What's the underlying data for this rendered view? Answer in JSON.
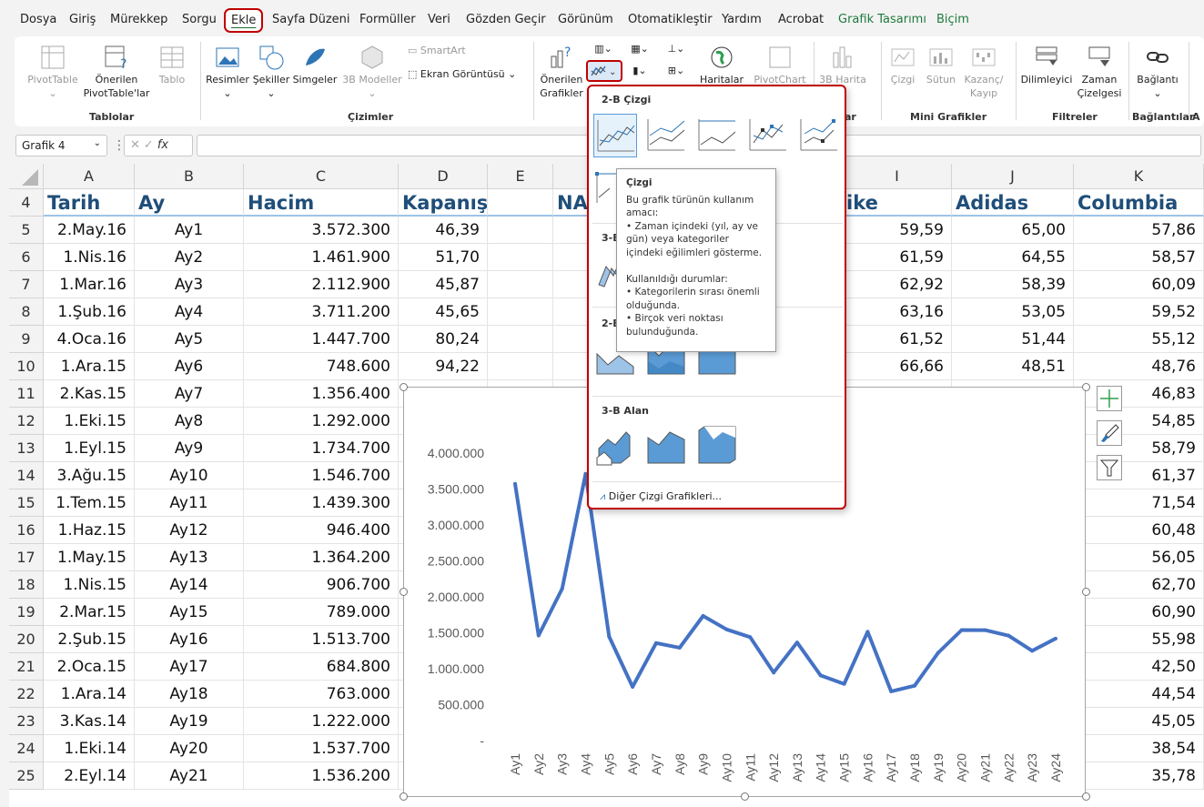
{
  "menu": {
    "tabs": [
      "Dosya",
      "Giriş",
      "Mürekkep",
      "Sorgu",
      "Ekle",
      "Sayfa Düzeni",
      "Formüller",
      "Veri",
      "Gözden Geçir",
      "Görünüm",
      "Otomatikleştir",
      "Yardım",
      "Acrobat",
      "Grafik Tasarımı",
      "Biçim"
    ],
    "active": "Ekle"
  },
  "ribbon": {
    "pivot_table": "PivotTable",
    "recommended_pivot_1": "Önerilen",
    "recommended_pivot_2": "PivotTable'lar",
    "table": "Tablo",
    "group_tables": "Tablolar",
    "pictures": "Resimler",
    "shapes": "Şekiller",
    "icons": "Simgeler",
    "models_3d": "3B Modeller",
    "smartart": "SmartArt",
    "screenshot": "Ekran Görüntüsü",
    "group_illustrations": "Çizimler",
    "recommended_charts_1": "Önerilen",
    "recommended_charts_2": "Grafikler",
    "maps": "Haritalar",
    "pivotchart": "PivotChart",
    "map_3d": "3B Harita",
    "group_charts_tail": "ar",
    "spark_line": "Çizgi",
    "spark_column": "Sütun",
    "spark_winloss_1": "Kazanç/",
    "spark_winloss_2": "Kayıp",
    "group_sparklines": "Mini Grafikler",
    "slicer": "Dilimleyici",
    "timeline_1": "Zaman",
    "timeline_2": "Çizelgesi",
    "group_filters": "Filtreler",
    "link": "Bağlantı",
    "group_links": "Bağlantılar",
    "group_tail": "A"
  },
  "formula_bar": {
    "name_box": "Grafik 4",
    "fx": "fx",
    "formula": ""
  },
  "columns": [
    "A",
    "B",
    "C",
    "D",
    "E",
    "",
    "",
    "",
    "",
    "I",
    "J",
    "K"
  ],
  "headers": {
    "row": "4",
    "tarih": "Tarih",
    "ay": "Ay",
    "hacim": "Hacim",
    "kapanis": "Kapanış",
    "na": "NA",
    "nike": "ike",
    "adidas": "Adidas",
    "columbia": "Columbia"
  },
  "rows": [
    {
      "n": "5",
      "tarih": "2.May.16",
      "ay": "Ay1",
      "hacim": "3.572.300",
      "kapanis": "46,39",
      "nike": "59,59",
      "adidas": "65,00",
      "columbia": "57,86"
    },
    {
      "n": "6",
      "tarih": "1.Nis.16",
      "ay": "Ay2",
      "hacim": "1.461.900",
      "kapanis": "51,70",
      "nike": "61,59",
      "adidas": "64,55",
      "columbia": "58,57"
    },
    {
      "n": "7",
      "tarih": "1.Mar.16",
      "ay": "Ay3",
      "hacim": "2.112.900",
      "kapanis": "45,87",
      "nike": "62,92",
      "adidas": "58,39",
      "columbia": "60,09"
    },
    {
      "n": "8",
      "tarih": "1.Şub.16",
      "ay": "Ay4",
      "hacim": "3.711.200",
      "kapanis": "45,65",
      "nike": "63,16",
      "adidas": "53,05",
      "columbia": "59,52"
    },
    {
      "n": "9",
      "tarih": "4.Oca.16",
      "ay": "Ay5",
      "hacim": "1.447.700",
      "kapanis": "80,24",
      "nike": "61,52",
      "adidas": "51,44",
      "columbia": "55,12"
    },
    {
      "n": "10",
      "tarih": "1.Ara.15",
      "ay": "Ay6",
      "hacim": "748.600",
      "kapanis": "94,22",
      "nike": "66,66",
      "adidas": "48,51",
      "columbia": "48,76"
    },
    {
      "n": "11",
      "tarih": "2.Kas.15",
      "ay": "Ay7",
      "hacim": "1.356.400",
      "kapanis": "",
      "nike": "",
      "adidas": "",
      "columbia": "46,83"
    },
    {
      "n": "12",
      "tarih": "1.Eki.15",
      "ay": "Ay8",
      "hacim": "1.292.000",
      "kapanis": "",
      "nike": "",
      "adidas": "",
      "columbia": "54,85"
    },
    {
      "n": "13",
      "tarih": "1.Eyl.15",
      "ay": "Ay9",
      "hacim": "1.734.700",
      "kapanis": "",
      "nike": "",
      "adidas": "",
      "columbia": "58,79"
    },
    {
      "n": "14",
      "tarih": "3.Ağu.15",
      "ay": "Ay10",
      "hacim": "1.546.700",
      "kapanis": "",
      "nike": "",
      "adidas": "",
      "columbia": "61,37"
    },
    {
      "n": "15",
      "tarih": "1.Tem.15",
      "ay": "Ay11",
      "hacim": "1.439.300",
      "kapanis": "",
      "nike": "",
      "adidas": "",
      "columbia": "71,54"
    },
    {
      "n": "16",
      "tarih": "1.Haz.15",
      "ay": "Ay12",
      "hacim": "946.400",
      "kapanis": "",
      "nike": "",
      "adidas": "",
      "columbia": "60,48"
    },
    {
      "n": "17",
      "tarih": "1.May.15",
      "ay": "Ay13",
      "hacim": "1.364.200",
      "kapanis": "",
      "nike": "",
      "adidas": "",
      "columbia": "56,05"
    },
    {
      "n": "18",
      "tarih": "1.Nis.15",
      "ay": "Ay14",
      "hacim": "906.700",
      "kapanis": "",
      "nike": "",
      "adidas": "",
      "columbia": "62,70"
    },
    {
      "n": "19",
      "tarih": "2.Mar.15",
      "ay": "Ay15",
      "hacim": "789.000",
      "kapanis": "",
      "nike": "",
      "adidas": "",
      "columbia": "60,90"
    },
    {
      "n": "20",
      "tarih": "2.Şub.15",
      "ay": "Ay16",
      "hacim": "1.513.700",
      "kapanis": "",
      "nike": "",
      "adidas": "",
      "columbia": "55,98"
    },
    {
      "n": "21",
      "tarih": "2.Oca.15",
      "ay": "Ay17",
      "hacim": "684.800",
      "kapanis": "",
      "nike": "",
      "adidas": "",
      "columbia": "42,50"
    },
    {
      "n": "22",
      "tarih": "1.Ara.14",
      "ay": "Ay18",
      "hacim": "763.000",
      "kapanis": "",
      "nike": "",
      "adidas": "",
      "columbia": "44,54"
    },
    {
      "n": "23",
      "tarih": "3.Kas.14",
      "ay": "Ay19",
      "hacim": "1.222.000",
      "kapanis": "",
      "nike": "",
      "adidas": "",
      "columbia": "45,05"
    },
    {
      "n": "24",
      "tarih": "1.Eki.14",
      "ay": "Ay20",
      "hacim": "1.537.700",
      "kapanis": "",
      "nike": "",
      "adidas": "",
      "columbia": "38,54"
    },
    {
      "n": "25",
      "tarih": "2.Eyl.14",
      "ay": "Ay21",
      "hacim": "1.536.200",
      "kapanis": "",
      "nike": "",
      "adidas": "",
      "columbia": "35,78"
    }
  ],
  "chart_data": {
    "type": "line",
    "categories": [
      "Ay1",
      "Ay2",
      "Ay3",
      "Ay4",
      "Ay5",
      "Ay6",
      "Ay7",
      "Ay8",
      "Ay9",
      "Ay10",
      "Ay11",
      "Ay12",
      "Ay13",
      "Ay14",
      "Ay15",
      "Ay16",
      "Ay17",
      "Ay18",
      "Ay19",
      "Ay20",
      "Ay21",
      "Ay22",
      "Ay23",
      "Ay24"
    ],
    "series": [
      {
        "values": [
          3572300,
          1461900,
          2112900,
          3711200,
          1447700,
          748600,
          1356400,
          1292000,
          1734700,
          1546700,
          1439300,
          946400,
          1364200,
          906700,
          789000,
          1513700,
          684800,
          763000,
          1222000,
          1537700,
          1536200,
          1460000,
          1250000,
          1420000
        ]
      }
    ],
    "yticks": [
      "4.000.000",
      "3.500.000",
      "3.000.000",
      "2.500.000",
      "2.000.000",
      "1.500.000",
      "1.000.000",
      "500.000",
      "-"
    ],
    "ylim": [
      0,
      4000000
    ],
    "color": "#4472c4",
    "grid": false
  },
  "gallery": {
    "section_2d_line": "2-B Çizgi",
    "section_3d_line": "3-B",
    "section_2d_area": "2-B",
    "section_3d_area": "3-B Alan",
    "more": "Diğer Çizgi Grafikleri..."
  },
  "tooltip": {
    "title": "Çizgi",
    "body": "Bu grafik türünün kullanım amacı:\n• Zaman içindeki (yıl, ay ve gün) veya kategoriler içindeki eğilimleri gösterme.\n\nKullanıldığı durumlar:\n• Kategorilerin sırası önemli olduğunda.\n• Birçok veri noktası bulunduğunda."
  }
}
